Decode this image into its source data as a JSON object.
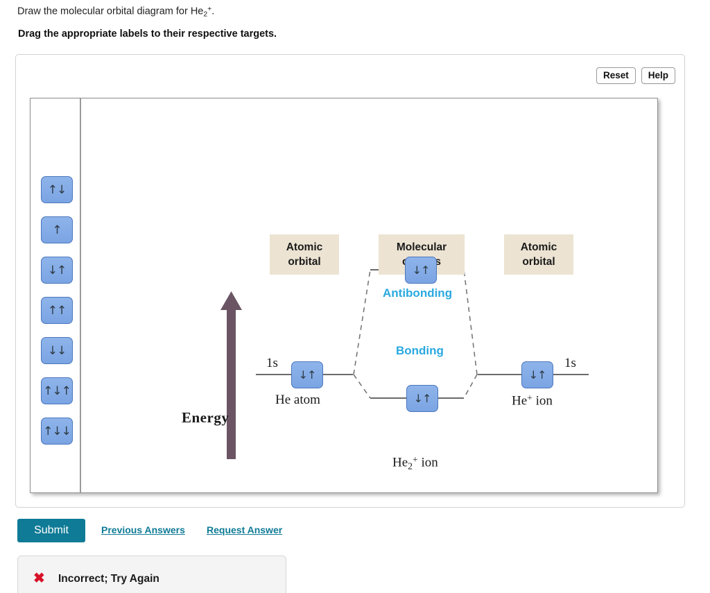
{
  "prompt": {
    "question_prefix": "Draw the molecular orbital diagram for He",
    "question_sub": "2",
    "question_sup": "+",
    "question_suffix": ".",
    "instruction": "Drag the appropriate labels to their respective targets."
  },
  "toolbar": {
    "reset_label": "Reset",
    "help_label": "Help"
  },
  "label_bank": {
    "items": [
      {
        "id": "tile-1",
        "glyph": "↑↓"
      },
      {
        "id": "tile-2",
        "glyph": "↑"
      },
      {
        "id": "tile-3",
        "glyph": "↓↑"
      },
      {
        "id": "tile-4",
        "glyph": "↑↑"
      },
      {
        "id": "tile-5",
        "glyph": "↓↓"
      },
      {
        "id": "tile-6",
        "glyph": "↑↓↑"
      },
      {
        "id": "tile-7",
        "glyph": "↑↓↓"
      }
    ]
  },
  "diagram": {
    "categories": [
      {
        "id": "cat-left",
        "line1": "Atomic",
        "line2": "orbital"
      },
      {
        "id": "cat-center",
        "line1": "Molecular",
        "line2": "orbitals"
      },
      {
        "id": "cat-right",
        "line1": "Atomic",
        "line2": "orbital"
      }
    ],
    "energy_label": "Energy",
    "energy_arrow_color": "#6b5564",
    "mo_label_color": "#29a9e0",
    "tile_color": "#7ba4e3",
    "left_orbital": {
      "shell_label": "1s",
      "species_label": "He atom",
      "placed_glyph": "↓↑"
    },
    "right_orbital": {
      "shell_label": "1s",
      "species_prefix": "He",
      "species_sup": "+",
      "species_suffix": " ion",
      "placed_glyph": "↓↑"
    },
    "antibonding": {
      "label": "Antibonding",
      "placed_glyph": "↓↑"
    },
    "bonding": {
      "label": "Bonding",
      "placed_glyph": "↓↑",
      "species_prefix": "He",
      "species_sub": "2",
      "species_sup": "+",
      "species_suffix": " ion"
    }
  },
  "footer": {
    "submit_label": "Submit",
    "previous_answers_label": "Previous Answers",
    "request_answer_label": "Request Answer",
    "accent_color": "#0f7b96"
  },
  "feedback": {
    "icon": "✖",
    "message": "Incorrect; Try Again",
    "icon_color": "#d8122a"
  }
}
